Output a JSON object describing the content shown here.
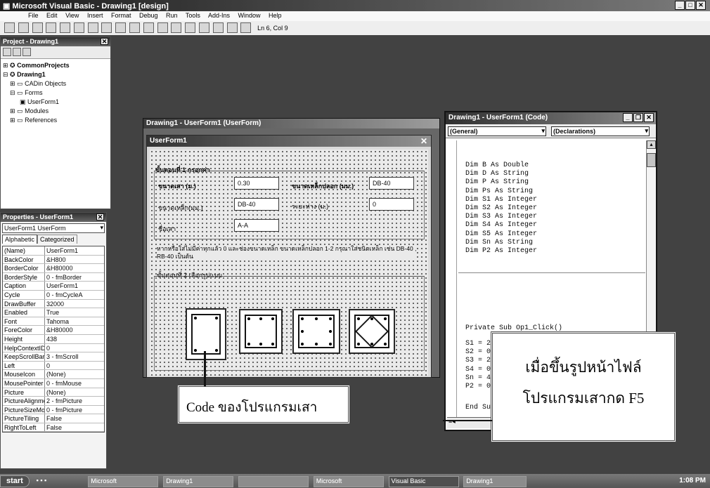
{
  "window": {
    "title": "Microsoft Visual Basic - Drawing1 [design]"
  },
  "menu": [
    "File",
    "Edit",
    "View",
    "Insert",
    "Format",
    "Debug",
    "Run",
    "Tools",
    "Add-Ins",
    "Window",
    "Help"
  ],
  "toolbar": {
    "cursor_pos": "Ln 6, Col 9"
  },
  "project_panel": {
    "title": "Project - Drawing1",
    "tree": [
      "CommonProjects",
      "Drawing1",
      "CADin Objects",
      "Forms",
      "UserForm1",
      "Modules",
      "References"
    ]
  },
  "properties_panel": {
    "title": "Properties - UserForm1",
    "object": "UserForm1 UserForm",
    "tabs": [
      "Alphabetic",
      "Categorized"
    ],
    "rows": [
      {
        "k": "(Name)",
        "v": "UserForm1"
      },
      {
        "k": "BackColor",
        "v": "&H800"
      },
      {
        "k": "BorderColor",
        "v": "&H80000"
      },
      {
        "k": "BorderStyle",
        "v": "0 - fmBorder"
      },
      {
        "k": "Caption",
        "v": "UserForm1"
      },
      {
        "k": "Cycle",
        "v": "0 - fmCycleA"
      },
      {
        "k": "DrawBuffer",
        "v": "32000"
      },
      {
        "k": "Enabled",
        "v": "True"
      },
      {
        "k": "Font",
        "v": "Tahoma"
      },
      {
        "k": "ForeColor",
        "v": "&H80000"
      },
      {
        "k": "Height",
        "v": "438"
      },
      {
        "k": "HelpContextID",
        "v": "0"
      },
      {
        "k": "KeepScrollBars",
        "v": "3 - fmScroll"
      },
      {
        "k": "Left",
        "v": "0"
      },
      {
        "k": "MouseIcon",
        "v": "(None)"
      },
      {
        "k": "MousePointer",
        "v": "0 - fmMouse"
      },
      {
        "k": "Picture",
        "v": "(None)"
      },
      {
        "k": "PictureAlignment",
        "v": "2 - fmPicture"
      },
      {
        "k": "PictureSizeMode",
        "v": "0 - fmPicture"
      },
      {
        "k": "PictureTiling",
        "v": "False"
      },
      {
        "k": "RightToLeft",
        "v": "False"
      }
    ]
  },
  "form_designer": {
    "title": "Drawing1 - UserForm1 (UserForm)",
    "form_caption": "UserForm1",
    "step1": "ขั้นตอนที่ 1 กรอกค่า",
    "width_label": "ขนาดเสา (ม.)",
    "width_value": "0.30",
    "outer_bar_label": "ขนาดเหล็กปลอก (มม.)",
    "outer_bar_value": "DB-40",
    "main_bar_label": "ขนาดเหล็ก(มม.)",
    "main_bar_value": "DB-40",
    "spacing_label": "ระยะห่าง (ม.)",
    "spacing_value": "0",
    "name_label": "ชื่อเสา",
    "name_value": "A-A",
    "note": "หากหรือใส่ไม่มีค่าทุกแล้ว 0 และช่องขนาดเหล็ก ขนาดเหล็กปลอก 1-2 กรุณาใส่ชนิดเหล็ก เช่น DB-40 , RB-40 เป็นต้น",
    "step2": "ขั้นตอนที่ 2 เลือกรูปแบบ"
  },
  "code_window": {
    "title": "Drawing1 - UserForm1 (Code)",
    "object_combo": "(General)",
    "proc_combo": "(Declarations)",
    "lines": [
      "Dim B As Double",
      "Dim D As String",
      "Dim P As String",
      "Dim Ps As String",
      "Dim S1 As Integer",
      "Dim S2 As Integer",
      "Dim S3 As Integer",
      "Dim S4 As Integer",
      "Dim S5 As Integer",
      "Dim Sn As String",
      "Dim P2 As Integer"
    ],
    "sub_line": "Private Sub Op1_Click()",
    "partial_lines": [
      "S1 = 2",
      "S2 = 0",
      "S3 = 2",
      "S4 = 0",
      "Sn = 4",
      "P2 = 0"
    ],
    "end_line": "End Sub"
  },
  "callouts": {
    "left": "Code ของโปรแกรมเสา",
    "right_line1": "เมื่อขึ้นรูปหน้าไฟล์",
    "right_line2": "โปรแกรมเสากด F5"
  },
  "taskbar": {
    "start": "start",
    "items": [
      "Microsoft",
      "Drawing1",
      "",
      "Microsoft",
      "Visual Basic",
      "Drawing1"
    ],
    "clock": "1:08 PM"
  }
}
